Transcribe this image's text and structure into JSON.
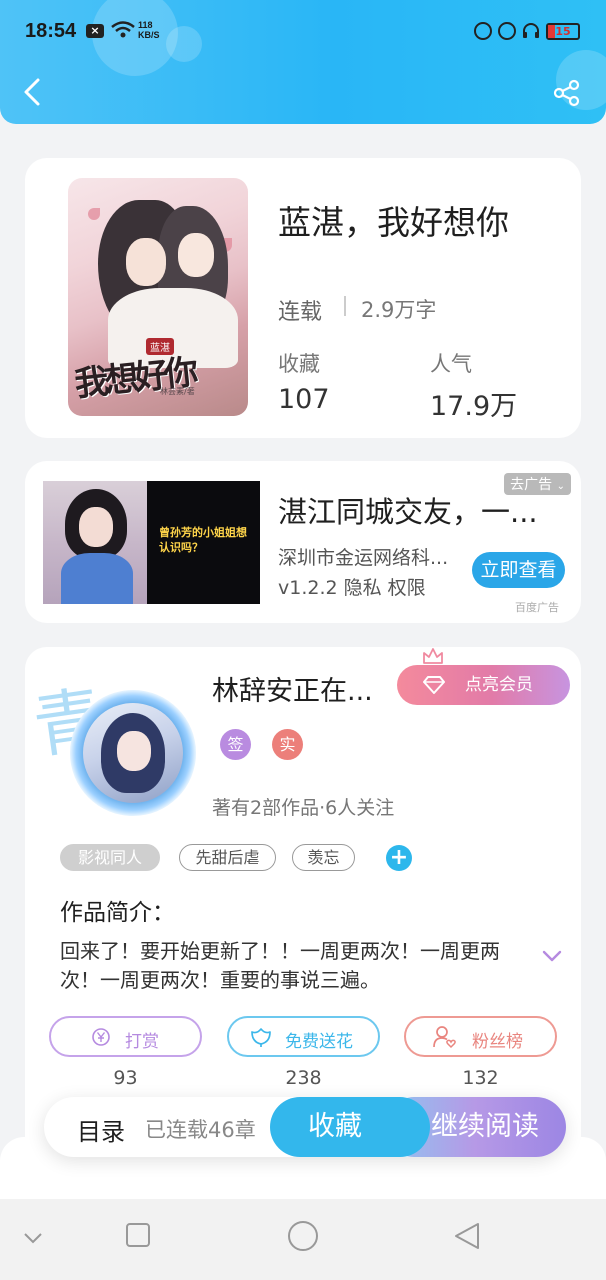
{
  "status_bar": {
    "time": "18:54",
    "net_speed_value": "118",
    "net_speed_unit": "KB/S",
    "battery": "15"
  },
  "header": {
    "back_icon": "chevron-left-icon",
    "share_icon": "share-icon"
  },
  "book": {
    "title": "蓝湛，我好想你",
    "status": "连载",
    "word_count": "2.9万字",
    "favorites_label": "收藏",
    "favorites_value": "107",
    "popularity_label": "人气",
    "popularity_value": "17.9万",
    "cover_art": {
      "tag": "蓝湛",
      "title": "我想好你",
      "author": "林芸素/著"
    }
  },
  "ad": {
    "dismiss": "去广告",
    "title": "湛江同城交友，一...",
    "company": "深圳市金运网络科...",
    "meta": "v1.2.2  隐私  权限",
    "cta": "立即查看",
    "source": "百度广告",
    "image_text": "曾孙芳的小姐姐想认识吗？"
  },
  "author": {
    "name": "林辞安正在...",
    "vip_button": "点亮会员",
    "badge_sign": "签",
    "badge_real": "实",
    "stats": "著有2部作品·6人关注",
    "tags": [
      "影视同人",
      "先甜后虐",
      "羡忘"
    ],
    "add_tag": "+",
    "intro_heading": "作品简介：",
    "intro_text": "回来了！要开始更新了！！一周更两次！一周更两次！一周更两次！重要的事说三遍。",
    "actions": [
      {
        "label": "打赏",
        "count": "93",
        "icon": "yen-coin-icon",
        "color": "#b58ae0"
      },
      {
        "label": "免费送花",
        "count": "238",
        "icon": "flower-icon",
        "color": "#3cb7ea"
      },
      {
        "label": "粉丝榜",
        "count": "132",
        "icon": "user-heart-icon",
        "color": "#e9857f"
      }
    ]
  },
  "bottom_bar": {
    "toc": "目录",
    "chapters": "已连载46章",
    "favorite": "收藏",
    "continue_reading": "继续阅读"
  },
  "colors": {
    "header_blue": "#29b6f6",
    "accent_blue": "#33b7ec",
    "vip_pink": "#f48a9c",
    "purple": "#b58ae0"
  }
}
